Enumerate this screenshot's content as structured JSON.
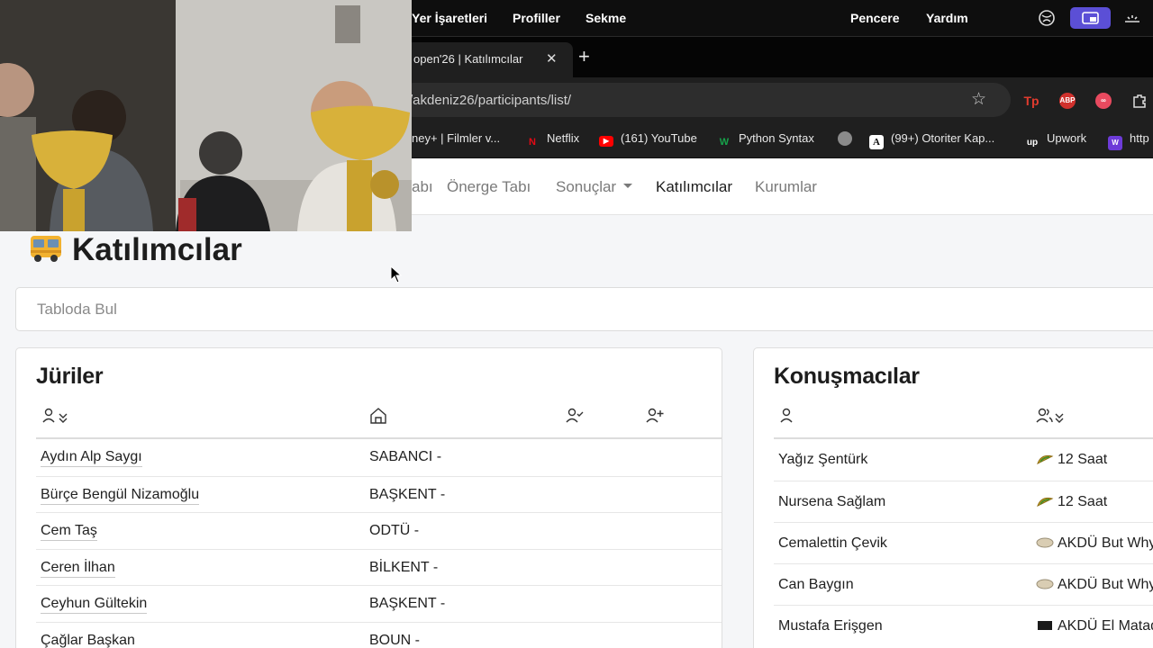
{
  "menubar": {
    "items": [
      "Yer İşaretleri",
      "Profiller",
      "Sekme",
      "Pencere",
      "Yardım"
    ]
  },
  "browser": {
    "tab_title": "open'26 | Katılımcılar",
    "tab_close": "✕",
    "new_tab": "+",
    "url": "/akdeniz26/participants/list/",
    "bookmark_star": "☆",
    "bookmarks": [
      "ney+ | Filmler v...",
      "Netflix",
      "(161) YouTube",
      "Python Syntax",
      "(99+) Otoriter Kap...",
      "Upwork",
      "http"
    ]
  },
  "nav": {
    "items": [
      "abı",
      "Önerge Tabı",
      "Sonuçlar",
      "Katılımcılar",
      "Kurumlar"
    ],
    "active": "Katılımcılar"
  },
  "page": {
    "title": "Katılımcılar",
    "search_placeholder": "Tabloda Bul"
  },
  "juriler": {
    "title": "Jüriler",
    "header_icons": [
      "person-sort-icon",
      "institution-icon",
      "person-check-icon",
      "person-add-icon"
    ],
    "rows": [
      {
        "name": "Aydın Alp Saygı",
        "institution": "SABANCI -"
      },
      {
        "name": "Bürçe Bengül Nizamoğlu",
        "institution": "BAŞKENT -"
      },
      {
        "name": "Cem Taş",
        "institution": "ODTÜ -"
      },
      {
        "name": "Ceren İlhan",
        "institution": "BİLKENT -"
      },
      {
        "name": "Ceyhun Gültekin",
        "institution": "BAŞKENT -"
      },
      {
        "name": "Çağlar Başkan",
        "institution": "BOUN -"
      }
    ]
  },
  "konusmacilar": {
    "title": "Konuşmacılar",
    "header_icons": [
      "person-icon",
      "team-sort-icon"
    ],
    "rows": [
      {
        "name": "Yağız Şentürk",
        "team": "12 Saat",
        "team_icon": "taco-icon"
      },
      {
        "name": "Nursena Sağlam",
        "team": "12 Saat",
        "team_icon": "taco-icon"
      },
      {
        "name": "Cemalettin Çevik",
        "team": "AKDÜ But Why",
        "team_icon": "flatbread-icon"
      },
      {
        "name": "Can Baygın",
        "team": "AKDÜ But Why",
        "team_icon": "flatbread-icon"
      },
      {
        "name": "Mustafa Erişgen",
        "team": "AKDÜ El Matad",
        "team_icon": "flag-icon"
      }
    ]
  }
}
